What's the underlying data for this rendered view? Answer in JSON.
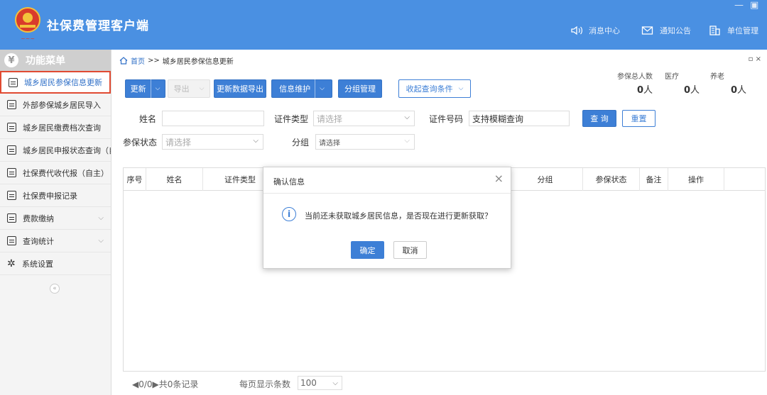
{
  "app": {
    "title": "社保费管理客户端",
    "window_controls": {
      "minimize": "—",
      "restore": "▣"
    },
    "nav": [
      {
        "label": "消息中心",
        "icon": "speaker-icon"
      },
      {
        "label": "通知公告",
        "icon": "mail-icon"
      },
      {
        "label": "单位管理",
        "icon": "building-icon"
      }
    ]
  },
  "sidebar": {
    "header": "功能菜单",
    "items": [
      {
        "label": "城乡居民参保信息更新"
      },
      {
        "label": "外部参保城乡居民导入"
      },
      {
        "label": "城乡居民缴费档次查询"
      },
      {
        "label": "城乡居民申报状态查询（自主"
      },
      {
        "label": "社保费代收代报（自主）"
      },
      {
        "label": "社保费申报记录"
      },
      {
        "label": "费款缴纳",
        "chevron": "⌵"
      },
      {
        "label": "查询统计",
        "chevron": "⌵"
      },
      {
        "label": "系统设置"
      }
    ],
    "collapse": "«"
  },
  "breadcrumb": {
    "home": "首页",
    "sep": ">>",
    "current": "城乡居民参保信息更新"
  },
  "corner_controls": "▫ ×",
  "toolbar": {
    "update": "更新",
    "export": "导出",
    "update_export": "更新数据导出",
    "info_maintain": "信息维护",
    "group_manage": "分组管理",
    "collapse_query": "收起查询条件",
    "chevron": "⌵"
  },
  "stats": {
    "total_label": "参保总人数",
    "medical_label": "医疗",
    "pension_label": "养老",
    "total_value": "0",
    "medical_value": "0",
    "pension_value": "0",
    "unit": "人"
  },
  "filters": {
    "name_label": "姓名",
    "name_value": "",
    "idtype_label": "证件类型",
    "idtype_placeholder": "请选择",
    "idno_label": "证件号码",
    "idno_value": "支持模糊查询",
    "status_label": "参保状态",
    "status_placeholder": "请选择",
    "group_label": "分组",
    "group_placeholder": "请选择",
    "query": "查 询",
    "reset": "重置"
  },
  "table": {
    "columns": [
      "序号",
      "姓名",
      "证件类型",
      "",
      "",
      "",
      "",
      "分组",
      "",
      "参保状态",
      "备注",
      "操作"
    ],
    "rows": []
  },
  "pager": {
    "summary": "◀0/0▶共0条记录",
    "page_size_label": "每页显示条数",
    "page_size": "100"
  },
  "dialog": {
    "title": "确认信息",
    "close": "×",
    "icon": "i",
    "message": "当前还未获取城乡居民信息，是否现在进行更新获取？",
    "ok": "确定",
    "cancel": "取消"
  }
}
